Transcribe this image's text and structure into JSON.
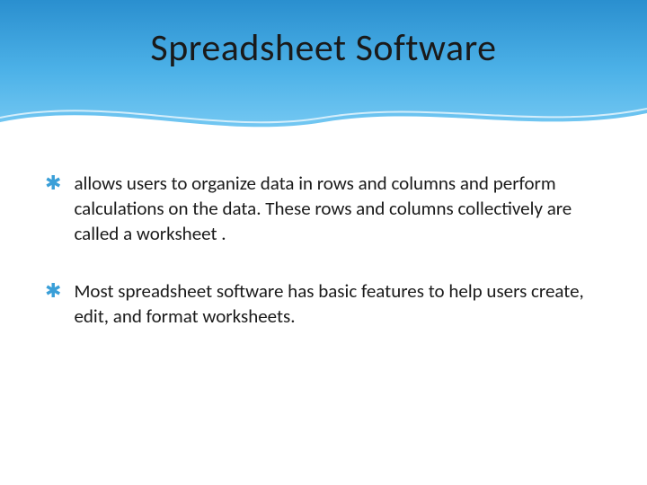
{
  "title": "Spreadsheet Software",
  "bullets": [
    {
      "text": "allows users to organize data in rows and columns and perform calculations on the data. These rows and columns collectively are called a worksheet ."
    },
    {
      "text": " Most spreadsheet software has basic features to help users create, edit, and format worksheets."
    }
  ],
  "bullet_glyph": "✱"
}
